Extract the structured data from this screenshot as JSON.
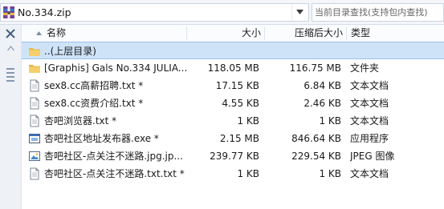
{
  "path": {
    "text": "No.334.zip"
  },
  "search": {
    "placeholder": "当前目录查找(支持包内查找)"
  },
  "columns": {
    "name": "名称",
    "size": "大小",
    "compressed": "压缩后大小",
    "type": "类型"
  },
  "rows": [
    {
      "icon": "folder-up-icon",
      "name": "..(上层目录)",
      "size": "",
      "compressed": "",
      "type": "",
      "selected": true
    },
    {
      "icon": "folder-icon",
      "name": "[Graphis] Gals No.334 JULIA...",
      "size": "118.05 MB",
      "compressed": "116.75 MB",
      "type": "文件夹"
    },
    {
      "icon": "text-file-icon",
      "name": "sex8.cc高薪招聘.txt *",
      "size": "17.15 KB",
      "compressed": "6.84 KB",
      "type": "文本文档"
    },
    {
      "icon": "text-file-icon",
      "name": "sex8.cc资费介绍.txt *",
      "size": "4.55 KB",
      "compressed": "2.46 KB",
      "type": "文本文档"
    },
    {
      "icon": "text-file-icon",
      "name": "杏吧浏览器.txt *",
      "size": "1 KB",
      "compressed": "1 KB",
      "type": "文本文档"
    },
    {
      "icon": "exe-file-icon",
      "name": "杏吧社区地址发布器.exe *",
      "size": "2.15 MB",
      "compressed": "846.64 KB",
      "type": "应用程序"
    },
    {
      "icon": "image-file-icon",
      "name": "杏吧社区-点关注不迷路.jpg.jp...",
      "size": "239.77 KB",
      "compressed": "229.54 KB",
      "type": "JPEG 图像"
    },
    {
      "icon": "text-file-icon",
      "name": "杏吧社区-点关注不迷路.txt.txt *",
      "size": "1 KB",
      "compressed": "1 KB",
      "type": "文本文档"
    }
  ],
  "colors": {
    "selection": "#cfe3f8",
    "folder": "#e9b949",
    "accent": "#3b6fb6"
  }
}
